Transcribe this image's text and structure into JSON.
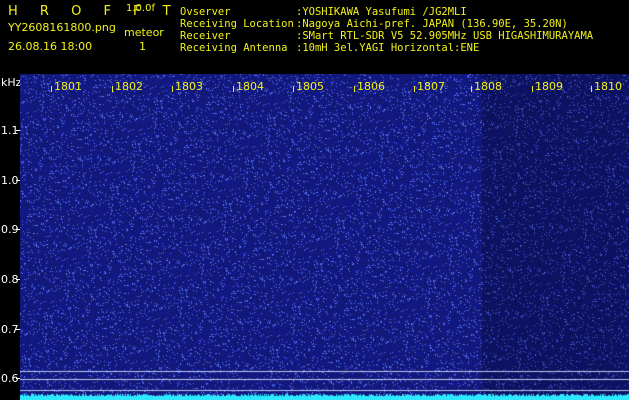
{
  "header": {
    "logo": "H R O F F T",
    "version": "1.0.0f",
    "filename": "YY2608161800.png",
    "datetime": "26.08.16 18:00",
    "meteor_label": "meteor",
    "meteor_count": "1",
    "info_labels": [
      "Ovserver",
      "Receiving Location",
      "Receiver",
      "Receiving Antenna"
    ],
    "info_values": [
      ":YOSHIKAWA Yasufumi /JG2MLI",
      ":Nagoya Aichi-pref. JAPAN (136.90E, 35.20N)",
      ":SMart RTL-SDR V5 52.905MHz USB HIGASHIMURAYAMA",
      ":10mH 3el.YAGI Horizontal:ENE"
    ]
  },
  "plot": {
    "y_unit": "kHz",
    "x_ticks": [
      "1801",
      "1802",
      "1803",
      "1804",
      "1805",
      "1806",
      "1807",
      "1808",
      "1809",
      "1810"
    ],
    "y_ticks": [
      "1.1",
      "1.0",
      "0.9",
      "0.8",
      "0.7",
      "0.6"
    ],
    "colors": {
      "background": "#1a2696",
      "dots": "#5a7cff",
      "band": "#2ee8ff",
      "text": "#f2f21a"
    }
  }
}
